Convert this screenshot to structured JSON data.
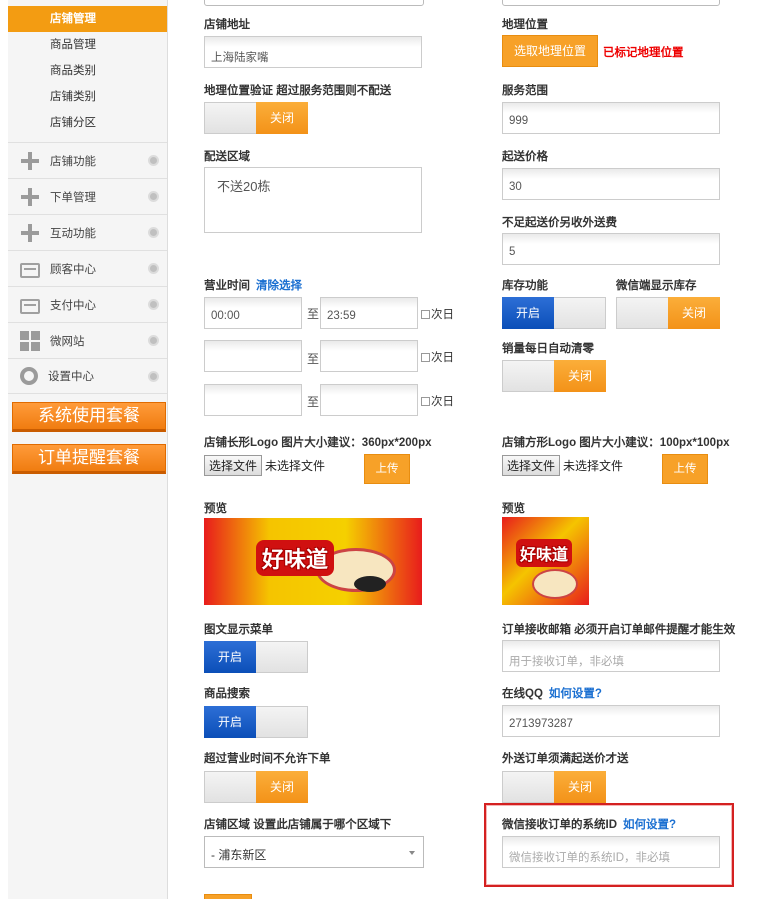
{
  "sidebar": {
    "sub_items": [
      "店铺管理",
      "商品管理",
      "商品类别",
      "店铺类别",
      "店铺分区"
    ],
    "nav_items": [
      {
        "label": "店铺功能",
        "icon": "plus-icon"
      },
      {
        "label": "下单管理",
        "icon": "plus-icon"
      },
      {
        "label": "互动功能",
        "icon": "plus-icon"
      },
      {
        "label": "顾客中心",
        "icon": "inbox-icon"
      },
      {
        "label": "支付中心",
        "icon": "inbox-icon"
      },
      {
        "label": "微网站",
        "icon": "grid-icon"
      },
      {
        "label": "设置中心",
        "icon": "gear-icon"
      }
    ],
    "package_buttons": [
      "系统使用套餐",
      "订单提醒套餐"
    ]
  },
  "form": {
    "shop_address": {
      "label": "店铺地址",
      "value": "上海陆家嘴"
    },
    "geo_location": {
      "label": "地理位置",
      "button": "选取地理位置",
      "status": "已标记地理位置"
    },
    "geo_verify": {
      "label": "地理位置验证 超过服务范围则不配送",
      "toggle": "关闭"
    },
    "service_range": {
      "label": "服务范围",
      "value": "999"
    },
    "delivery_area": {
      "label": "配送区域",
      "value": "不送20栋"
    },
    "min_price": {
      "label": "起送价格",
      "value": "30"
    },
    "extra_fee": {
      "label": "不足起送价另收外送费",
      "value": "5"
    },
    "business_hours": {
      "label": "营业时间",
      "clear_link": "清除选择",
      "sep": "至",
      "next_day": "次日",
      "rows": [
        {
          "start": "00:00",
          "end": "23:59"
        },
        {
          "start": "",
          "end": ""
        },
        {
          "start": "",
          "end": ""
        }
      ]
    },
    "inventory": {
      "label": "库存功能",
      "toggle": "开启"
    },
    "wechat_stock": {
      "label": "微信端显示库存",
      "toggle": "关闭"
    },
    "daily_reset": {
      "label": "销量每日自动清零",
      "toggle": "关闭"
    },
    "logo_wide": {
      "label": "店铺长形Logo 图片大小建议：360px*200px",
      "choose": "选择文件",
      "no_file": "未选择文件",
      "upload": "上传",
      "preview": "预览",
      "logo_text": "好味道"
    },
    "logo_square": {
      "label": "店铺方形Logo 图片大小建议：100px*100px",
      "choose": "选择文件",
      "no_file": "未选择文件",
      "upload": "上传",
      "preview": "预览",
      "logo_text": "好味道"
    },
    "menu_display": {
      "label": "图文显示菜单",
      "toggle": "开启"
    },
    "order_email": {
      "label": "订单接收邮箱 必须开启订单邮件提醒才能生效",
      "placeholder": "用于接收订单，非必填"
    },
    "product_search": {
      "label": "商品搜索",
      "toggle": "开启"
    },
    "online_qq": {
      "label": "在线QQ",
      "link": "如何设置?",
      "value": "2713973287"
    },
    "no_order_after_hours": {
      "label": "超过营业时间不允许下单",
      "toggle": "关闭"
    },
    "delivery_min_required": {
      "label": "外送订单须满起送价才送",
      "toggle": "关闭"
    },
    "shop_region": {
      "label": "店铺区域 设置此店铺属于哪个区域下",
      "selected": "- 浦东新区"
    },
    "wechat_order_id": {
      "label": "微信接收订单的系统ID",
      "link": "如何设置?",
      "placeholder": "微信接收订单的系统ID，非必填"
    }
  }
}
